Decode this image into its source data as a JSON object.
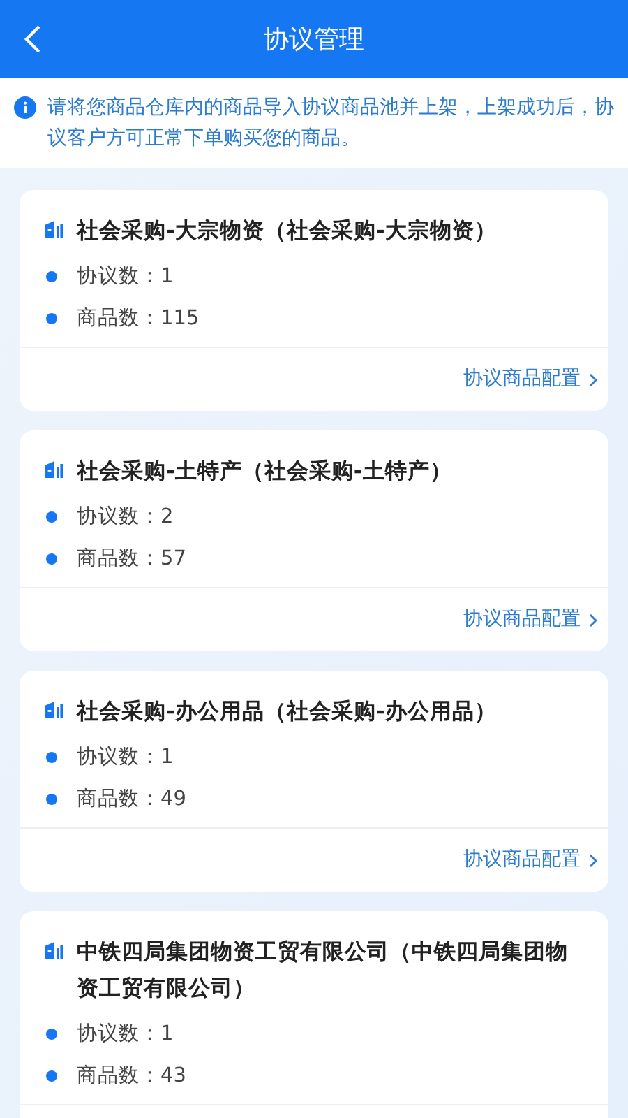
{
  "header": {
    "title": "协议管理"
  },
  "notice": "请将您商品仓库内的商品导入协议商品池并上架，上架成功后，协议客户方可正常下单购买您的商品。",
  "cards": [
    {
      "title": "社会采购-大宗物资（社会采购-大宗物资）",
      "stats": [
        "协议数：1",
        "商品数：115"
      ],
      "link": "协议商品配置"
    },
    {
      "title": "社会采购-土特产（社会采购-土特产）",
      "stats": [
        "协议数：2",
        "商品数：57"
      ],
      "link": "协议商品配置"
    },
    {
      "title": "社会采购-办公用品（社会采购-办公用品）",
      "stats": [
        "协议数：1",
        "商品数：49"
      ],
      "link": "协议商品配置"
    },
    {
      "title": "中铁四局集团物资工贸有限公司（中铁四局集团物资工贸有限公司）",
      "stats": [
        "协议数：1",
        "商品数：43"
      ]
    }
  ]
}
